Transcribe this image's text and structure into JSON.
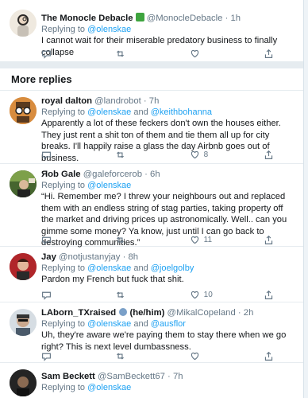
{
  "top_tweet": {
    "name": "The Monocle Debacle",
    "handle": "@MonocleDebacle",
    "time": "1h",
    "reply_prefix": "Replying to ",
    "mentions": [
      "@olenskae"
    ],
    "text": "I cannot wait for their miserable predatory business to finally collapse"
  },
  "section_title": "More replies",
  "replies": [
    {
      "name": "royal dalton",
      "handle": "@landrobot",
      "time": "7h",
      "reply_prefix": "Replying to ",
      "mentions": [
        "@olenskae",
        "@keithbohanna"
      ],
      "and": " and ",
      "text": "Apparently a lot of these feckers don't own the houses either. They just rent a shit ton of them and tie them all up for city breaks. I'll happily raise a glass the day Airbnb goes out of business.",
      "likes": "8"
    },
    {
      "name": "Яob Gale",
      "handle": "@galeforcerob",
      "time": "6h",
      "reply_prefix": "Replying to ",
      "mentions": [
        "@olenskae"
      ],
      "text": "“Hi. Remember me? I threw your neighbours out and replaced them with an endless string of stag parties, taking property off the market and driving prices up astronomically. Well.. can you gimme some money? Ya know, just until I can go back to destroying communities.”",
      "likes": "11"
    },
    {
      "name": "Jay",
      "handle": "@notjustanyjay",
      "time": "8h",
      "reply_prefix": "Replying to ",
      "mentions": [
        "@olenskae",
        "@joelgolby"
      ],
      "and": " and ",
      "text": "Pardon my French but fuck that shit.",
      "likes": "10"
    },
    {
      "name": "LAborn_TXraised",
      "name_suffix": "(he/him)",
      "handle": "@MikalCopeland",
      "time": "2h",
      "reply_prefix": "Replying to ",
      "mentions": [
        "@olenskae",
        "@ausflor"
      ],
      "and": " and ",
      "text": "Uh, they're aware we're paying them to stay there when we go right? This is next level dumbassness."
    },
    {
      "name": "Sam Beckett",
      "handle": "@SamBeckett67",
      "time": "7h",
      "reply_prefix": "Replying to ",
      "mentions": [
        "@olenskae"
      ]
    }
  ],
  "separator": "·",
  "icons": [
    "reply-icon",
    "retweet-icon",
    "like-icon",
    "share-icon"
  ],
  "colors": {
    "link": "#1da1f2",
    "muted": "#657786",
    "border": "#e6ecf0"
  }
}
